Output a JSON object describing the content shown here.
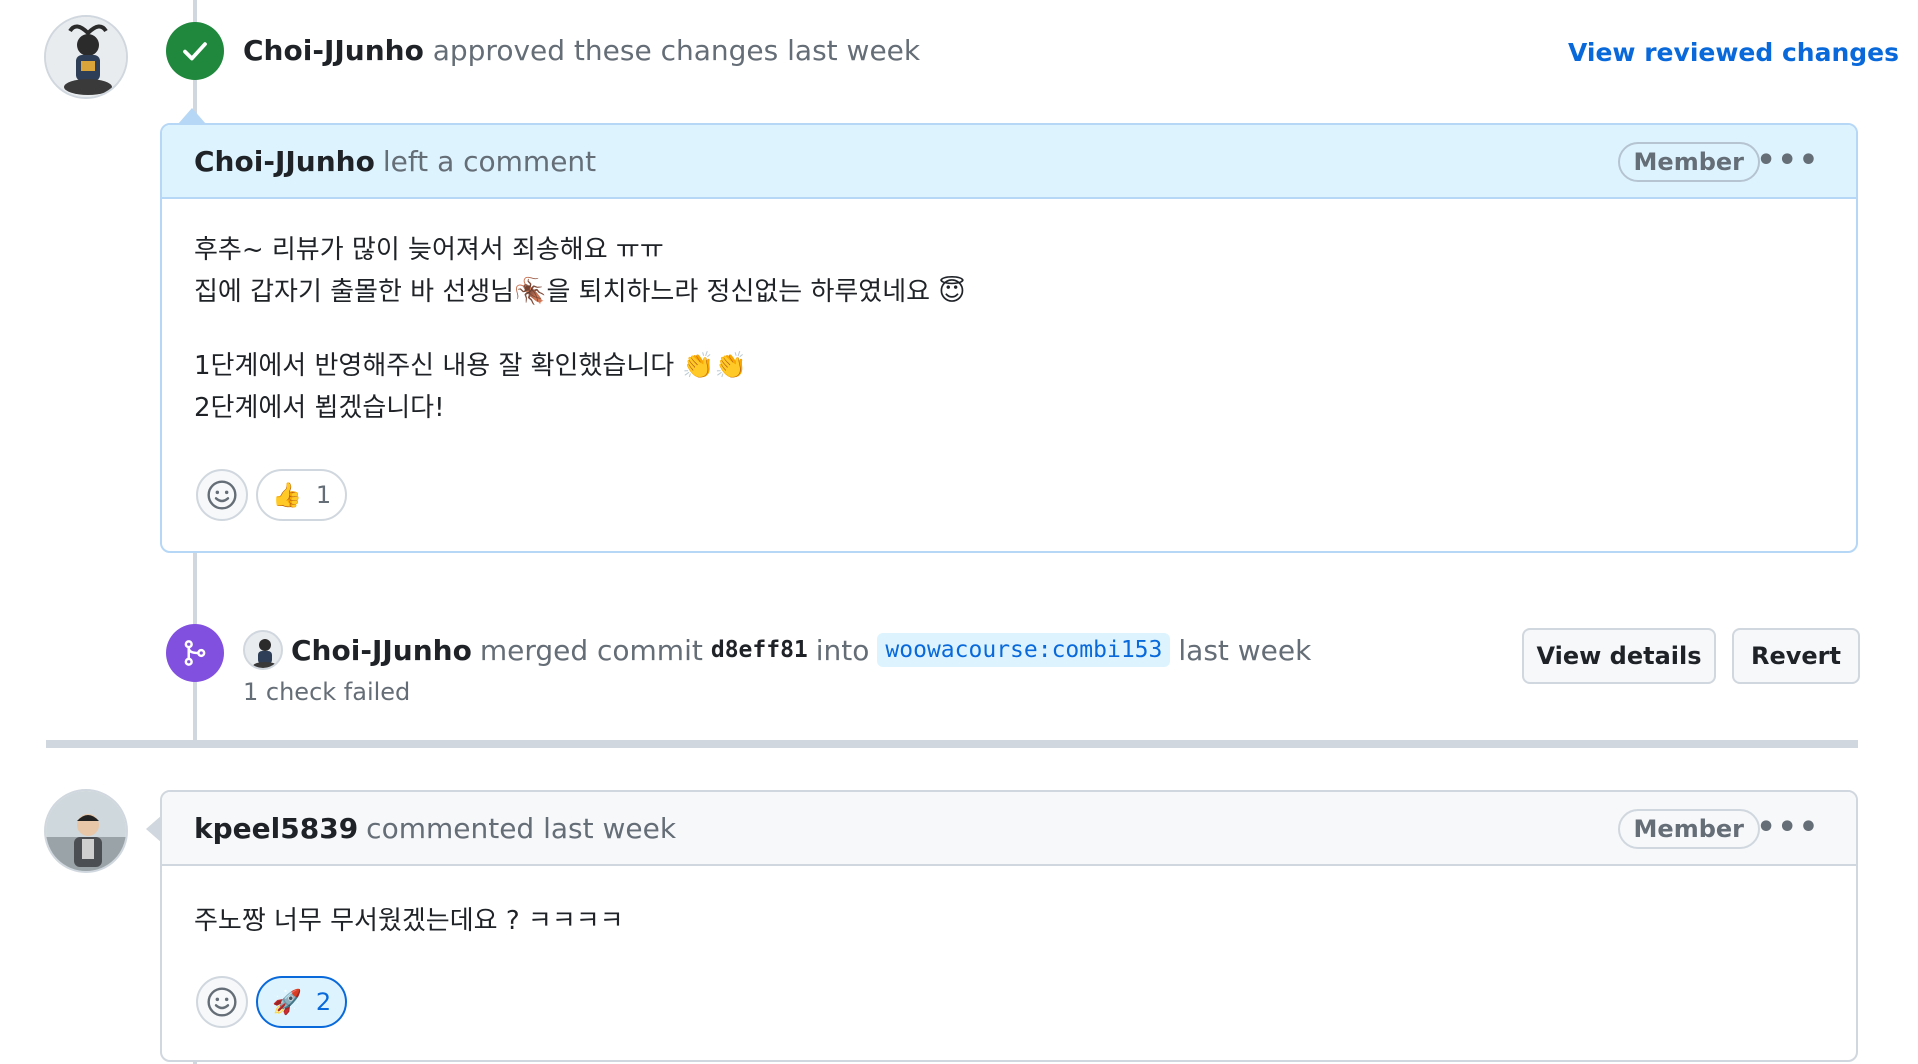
{
  "review": {
    "author": "Choi-JJunho",
    "action": "approved these changes",
    "time": "last week",
    "view_link": "View reviewed changes"
  },
  "comment1": {
    "author": "Choi-JJunho",
    "action": "left a comment",
    "role": "Member",
    "lines": [
      "후추~ 리뷰가 많이 늦어져서 죄송해요 ㅠㅠ",
      "집에 갑자기 출몰한 바 선생님🪳을 퇴치하느라 정신없는 하루였네요 😇",
      "1단계에서 반영해주신 내용 잘 확인했습니다 👏👏",
      "2단계에서 뵙겠습니다!"
    ],
    "reaction_emoji": "👍",
    "reaction_count": "1"
  },
  "merge": {
    "author": "Choi-JJunho",
    "action": "merged commit",
    "commit": "d8eff81",
    "into": "into",
    "branch": "woowacourse:combi153",
    "time": "last week",
    "status": "1 check failed",
    "view_details": "View details",
    "revert": "Revert"
  },
  "comment2": {
    "author": "kpeel5839",
    "action": "commented last week",
    "role": "Member",
    "text": "주노짱 너무 무서웠겠는데요 ? ㅋㅋㅋㅋ",
    "reaction_emoji": "🚀",
    "reaction_count": "2"
  },
  "colors": {
    "approve": "#1f883d",
    "merge": "#8250df",
    "link": "#0969da"
  }
}
